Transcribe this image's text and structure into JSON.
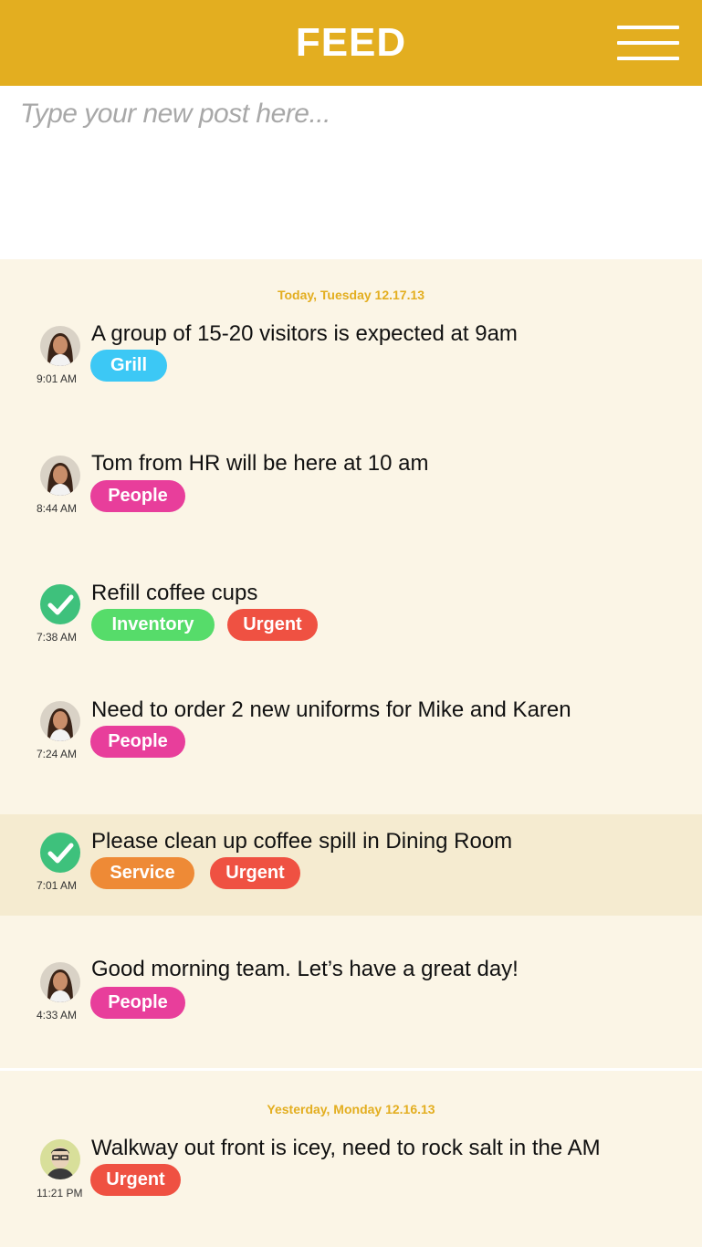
{
  "header": {
    "title": "FEED",
    "menu_icon": "hamburger-menu-icon"
  },
  "composer": {
    "placeholder": "Type your new post here..."
  },
  "sections": [
    {
      "date": "Today, Tuesday 12.17.13",
      "posts": [
        {
          "text": "A group of 15-20 visitors is expected at 9am",
          "time": "9:01 AM",
          "tags": [
            "Grill"
          ],
          "avatar": "woman-avatar"
        },
        {
          "text": "Tom from HR will be here at 10 am",
          "time": "8:44 AM",
          "tags": [
            "People"
          ],
          "avatar": "woman-avatar"
        },
        {
          "text": "Refill coffee cups",
          "time": "7:38 AM",
          "tags": [
            "Inventory",
            "Urgent"
          ],
          "avatar": "check-icon"
        },
        {
          "text": "Need to order 2 new uniforms for Mike and Karen",
          "time": "7:24 AM",
          "tags": [
            "People"
          ],
          "avatar": "woman-avatar"
        },
        {
          "text": "Please clean up coffee spill in Dining Room",
          "time": "7:01 AM",
          "tags": [
            "Service",
            "Urgent"
          ],
          "avatar": "check-icon"
        },
        {
          "text": "Good morning team. Let’s have a great day!",
          "time": "4:33 AM",
          "tags": [
            "People"
          ],
          "avatar": "woman-avatar"
        }
      ]
    },
    {
      "date": "Yesterday, Monday 12.16.13",
      "posts": [
        {
          "text": "Walkway out front is icey, need to rock salt in the AM",
          "time": "11:21 PM",
          "tags": [
            "Urgent"
          ],
          "avatar": "man-avatar"
        }
      ]
    }
  ],
  "colors": {
    "brand": "#e3ae20",
    "grill": "#3cc8f5",
    "people": "#e83e9b",
    "inventory": "#56dc6a",
    "urgent": "#ef5142",
    "service": "#ee8a36",
    "done": "#3ec17c"
  }
}
